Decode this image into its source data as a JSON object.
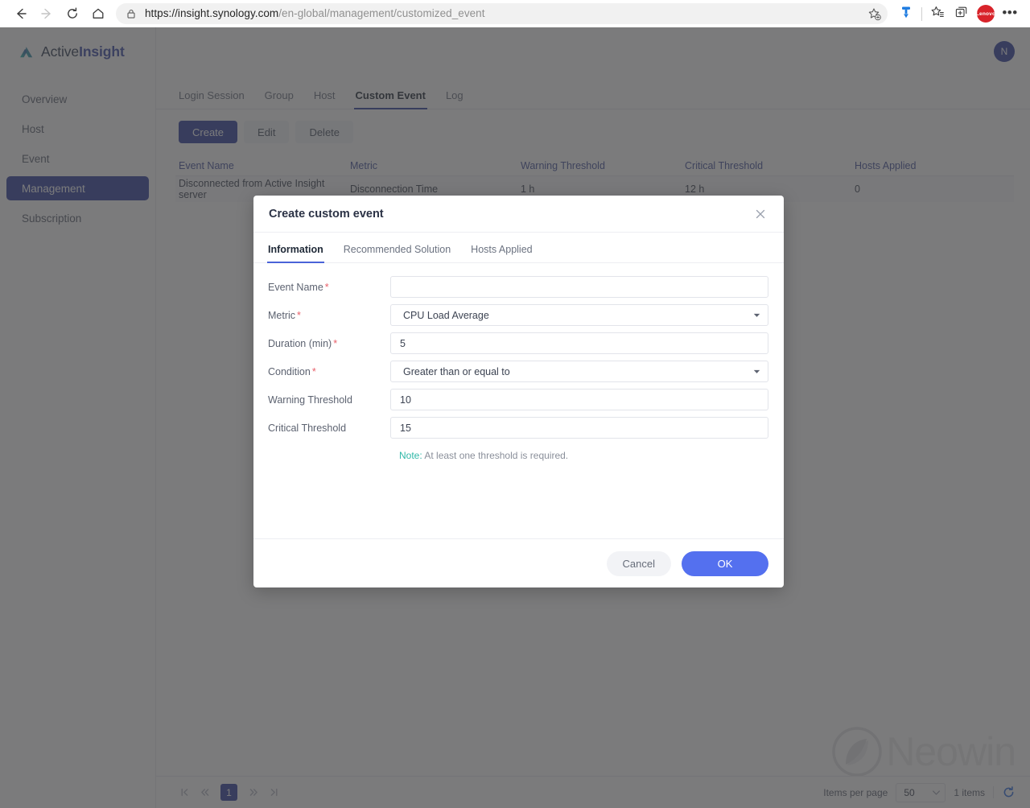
{
  "browser": {
    "back_icon": "back-arrow-icon",
    "forward_icon": "forward-arrow-icon",
    "reload_icon": "reload-icon",
    "home_icon": "home-icon",
    "lock_icon": "lock-icon",
    "url_domain": "https://insight.synology.com",
    "url_path": "/en-global/management/customized_event",
    "url_full": "https://insight.synology.com/en-global/management/customized_event",
    "add_favorite_icon": "add-favorite-star-icon",
    "extension_icon": "extension-icon",
    "favorites_icon": "favorites-list-icon",
    "collections_icon": "tab-collections-icon",
    "profile_label": "Lenovo",
    "settings_label": "•••"
  },
  "sidebar": {
    "logo_icon": "activeinsight-logo-icon",
    "logo_text_1": "Active",
    "logo_text_2": "Insight",
    "items": [
      {
        "label": "Overview",
        "active": false
      },
      {
        "label": "Host",
        "active": false
      },
      {
        "label": "Event",
        "active": false
      },
      {
        "label": "Management",
        "active": true
      },
      {
        "label": "Subscription",
        "active": false
      }
    ]
  },
  "topbar": {
    "avatar_initial": "N"
  },
  "tabs": [
    {
      "label": "Login Session",
      "active": false
    },
    {
      "label": "Group",
      "active": false
    },
    {
      "label": "Host",
      "active": false
    },
    {
      "label": "Custom Event",
      "active": true
    },
    {
      "label": "Log",
      "active": false
    }
  ],
  "toolbar": {
    "create_label": "Create",
    "edit_label": "Edit",
    "delete_label": "Delete"
  },
  "table": {
    "headers": [
      "Event Name",
      "Metric",
      "Warning Threshold",
      "Critical Threshold",
      "Hosts Applied"
    ],
    "rows": [
      {
        "event_name": "Disconnected from Active Insight server",
        "metric": "Disconnection Time",
        "warning_threshold": "1 h",
        "critical_threshold": "12 h",
        "hosts_applied": "0"
      }
    ]
  },
  "pagination": {
    "first_icon": "first-page-icon",
    "prev_icon": "previous-page-icon",
    "current_page": "1",
    "next_icon": "next-page-icon",
    "last_icon": "last-page-icon",
    "items_per_page_label": "Items per page",
    "items_per_page_value": "50",
    "item_count": "1 items",
    "refresh_icon": "refresh-icon"
  },
  "watermark": {
    "text": "Neowin",
    "icon": "neowin-logo-icon"
  },
  "modal": {
    "title": "Create custom event",
    "close_icon": "close-icon",
    "tabs": [
      {
        "label": "Information",
        "active": true
      },
      {
        "label": "Recommended Solution",
        "active": false
      },
      {
        "label": "Hosts Applied",
        "active": false
      }
    ],
    "fields": [
      {
        "label": "Event Name",
        "required": true,
        "type": "text",
        "value": "",
        "placeholder": ""
      },
      {
        "label": "Metric",
        "required": true,
        "type": "select",
        "value": "CPU Load Average"
      },
      {
        "label": "Duration (min)",
        "required": true,
        "type": "text",
        "value": "5"
      },
      {
        "label": "Condition",
        "required": true,
        "type": "select",
        "value": "Greater than or equal to"
      },
      {
        "label": "Warning Threshold",
        "required": false,
        "type": "text",
        "value": "10"
      },
      {
        "label": "Critical Threshold",
        "required": false,
        "type": "text",
        "value": "15"
      }
    ],
    "note_tag": "Note:",
    "note_text": " At least one threshold is required.",
    "cancel_label": "Cancel",
    "ok_label": "OK"
  },
  "colors": {
    "brand_navy": "#2f3f9e",
    "modal_primary": "#5470ef",
    "required_red": "#e8606a",
    "note_teal": "#2fb8a8",
    "lenovo_red": "#d8232a"
  }
}
